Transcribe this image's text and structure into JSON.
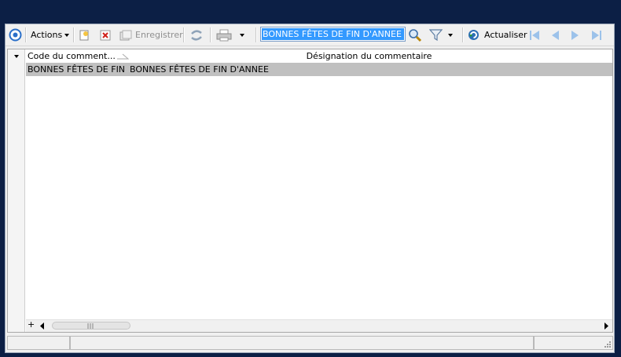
{
  "toolbar": {
    "actions_label": "Actions",
    "save_label": "Enregistrer",
    "refresh_label": "Actualiser",
    "search_value": "BONNES FÊTES DE FIN D'ANNEE"
  },
  "grid": {
    "columns": [
      "Code du comment...",
      "Désignation du commentaire"
    ],
    "rows": [
      [
        "BONNES FÊTES DE FIN D",
        "BONNES FÊTES DE FIN D'ANNEE"
      ]
    ]
  },
  "colors": {
    "background": "#0c1f45",
    "selection": "#3399ff",
    "selected_row": "#c0c0c0"
  }
}
